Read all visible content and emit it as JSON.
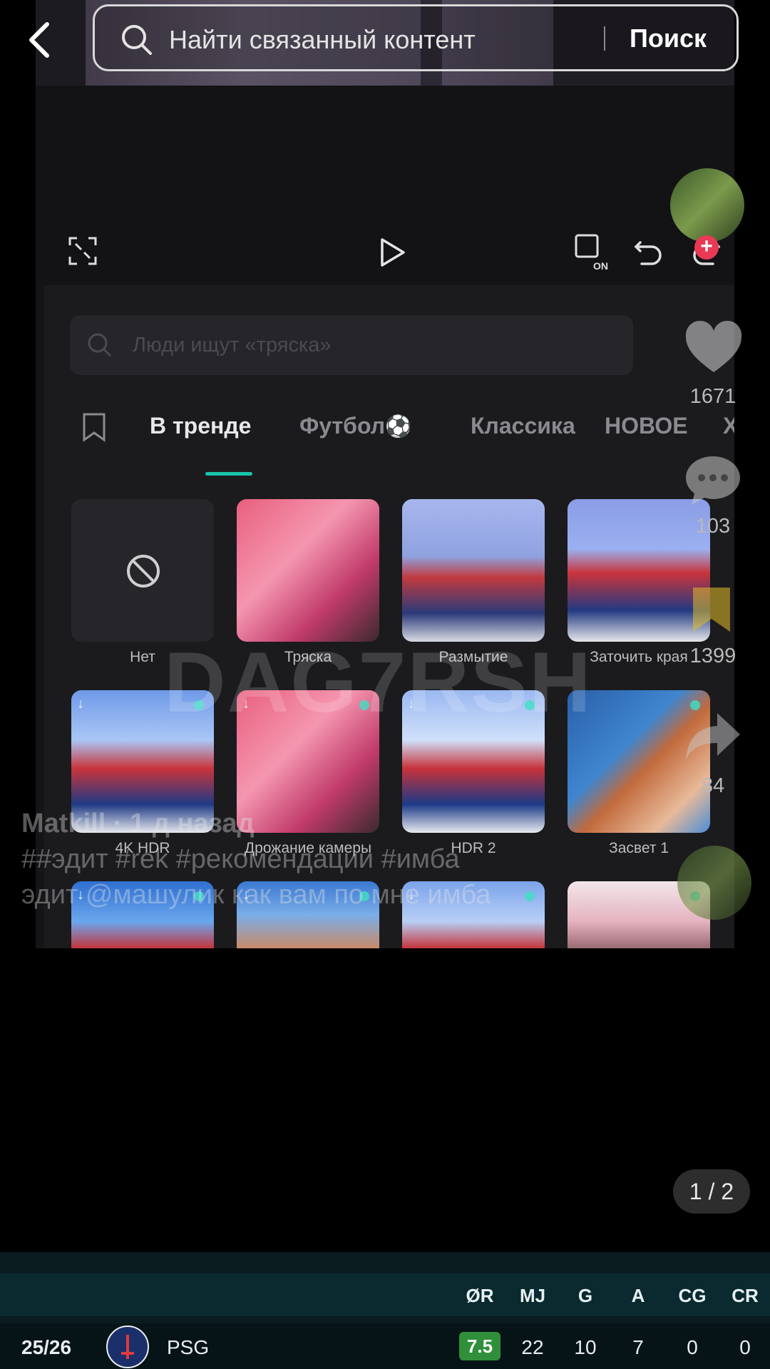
{
  "top_search": {
    "placeholder": "Найти связанный контент",
    "button": "Поиск"
  },
  "editor": {
    "inner_search_placeholder": "Люди ищут «тряска»",
    "tabs": [
      "В тренде",
      "Футбол",
      "Классика",
      "НОВОЕ",
      "Хит"
    ],
    "effects": [
      {
        "label": "Нет"
      },
      {
        "label": "Тряска"
      },
      {
        "label": "Размытие"
      },
      {
        "label": "Заточить края"
      },
      {
        "label": "4K HDR"
      },
      {
        "label": "Дрожание камеры"
      },
      {
        "label": "HDR 2"
      },
      {
        "label": "Засвет 1"
      }
    ]
  },
  "side_actions": {
    "likes": "1671",
    "comments": "103",
    "saves": "1399",
    "shares": "84"
  },
  "watermark": "DAG7RSH",
  "caption": {
    "line1": "Matkill  · 1 д назад",
    "line2": "##эдит #rek #рекомендации #имба",
    "line3": "эдит @машулик как вам по мне имба"
  },
  "page_indicator": "1 / 2",
  "stats": {
    "headers": [
      "ØR",
      "MJ",
      "G",
      "A",
      "CG",
      "CR"
    ],
    "season": "25/26",
    "club": "PSG",
    "rating": "7.5",
    "values": [
      "22",
      "10",
      "7",
      "0",
      "0"
    ],
    "colors": {
      "rating_bg": "#2f8f3a",
      "bar_bg": "#0a2a30"
    }
  }
}
